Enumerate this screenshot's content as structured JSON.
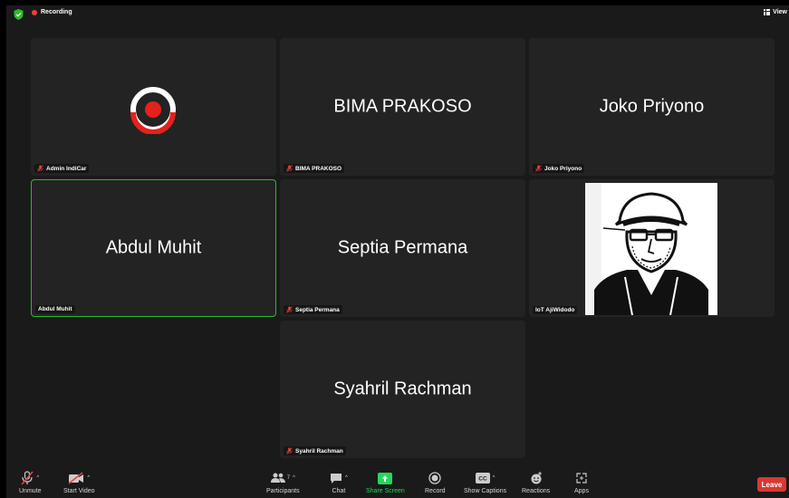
{
  "topbar": {
    "recording_label": "Recording",
    "view_label": "View"
  },
  "tiles": [
    {
      "display": "",
      "tag": "Admin IndiCar",
      "muted": true,
      "type": "logo"
    },
    {
      "display": "BIMA PRAKOSO",
      "tag": "BIMA PRAKOSO",
      "muted": true,
      "type": "name"
    },
    {
      "display": "Joko Priyono",
      "tag": "Joko Priyono",
      "muted": true,
      "type": "name"
    },
    {
      "display": "Abdul Muhit",
      "tag": "Abdul Muhit",
      "muted": false,
      "type": "name",
      "active_speaker": true
    },
    {
      "display": "Septia Permana",
      "tag": "Septia Permana",
      "muted": true,
      "type": "name"
    },
    {
      "display": "",
      "tag": "IoT AjiWidodo",
      "muted": false,
      "type": "photo"
    },
    {
      "display": "Syahril Rachman",
      "tag": "Syahril Rachman",
      "muted": true,
      "type": "name"
    }
  ],
  "toolbar": {
    "unmute": "Unmute",
    "start_video": "Start Video",
    "participants": "Participants",
    "participants_count": "7",
    "chat": "Chat",
    "share_screen": "Share Screen",
    "record": "Record",
    "show_captions": "Show Captions",
    "reactions": "Reactions",
    "apps": "Apps",
    "leave": "Leave"
  },
  "colors": {
    "recording": "#e8423c",
    "active_speaker_border": "#2fb82f",
    "share_screen": "#23d959",
    "leave": "#d93833",
    "mute": "#e8423c"
  }
}
